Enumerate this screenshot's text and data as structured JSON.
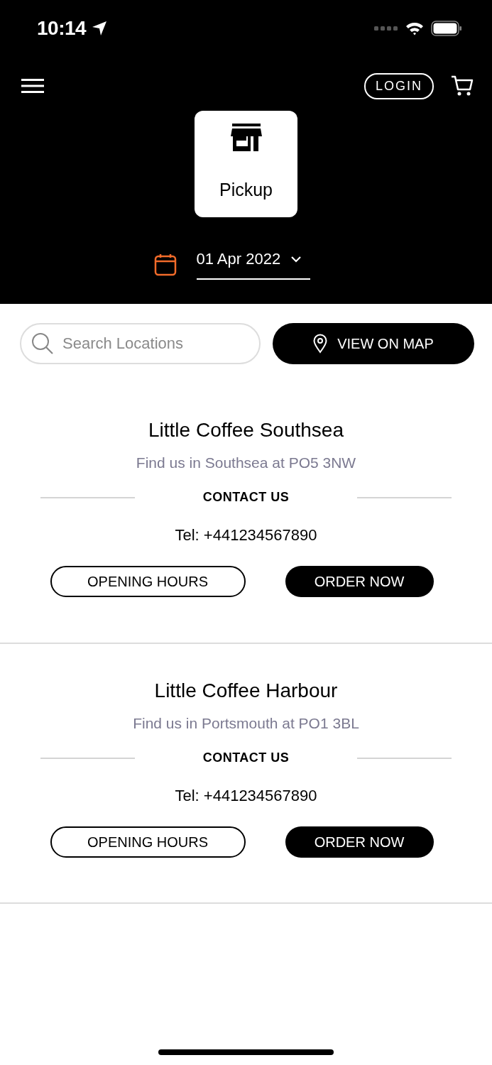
{
  "status_bar": {
    "time": "10:14"
  },
  "header": {
    "login": "LOGIN",
    "mode": {
      "label": "Pickup",
      "selected": true
    },
    "date": "01 Apr 2022"
  },
  "search": {
    "placeholder": "Search Locations"
  },
  "map_button": "VIEW ON MAP",
  "locations": [
    {
      "name": "Little Coffee Southsea",
      "subtitle": "Find us in Southsea at PO5 3NW",
      "contact_heading": "CONTACT US",
      "phone": "Tel: +441234567890",
      "hours_button": "OPENING HOURS",
      "order_button": "ORDER NOW"
    },
    {
      "name": "Little Coffee Harbour",
      "subtitle": "Find us in Portsmouth at PO1 3BL",
      "contact_heading": "CONTACT US",
      "phone": "Tel: +441234567890",
      "hours_button": "OPENING HOURS",
      "order_button": "ORDER NOW"
    }
  ]
}
